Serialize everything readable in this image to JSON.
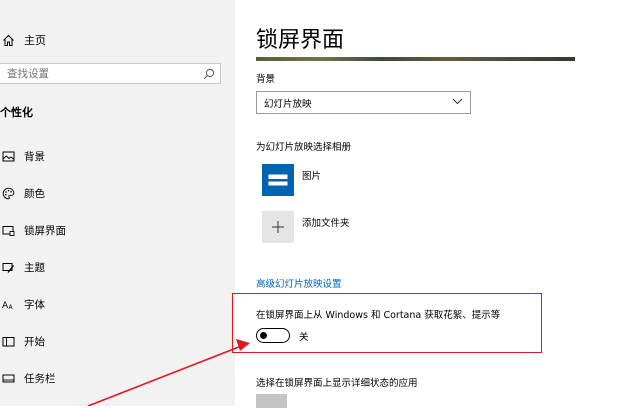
{
  "sidebar": {
    "home_label": "主页",
    "search_placeholder": "查找设置",
    "section_title": "个性化",
    "items": [
      {
        "label": "背景",
        "icon": "picture-icon"
      },
      {
        "label": "颜色",
        "icon": "palette-icon"
      },
      {
        "label": "锁屏界面",
        "icon": "lock-screen-icon"
      },
      {
        "label": "主题",
        "icon": "brush-icon"
      },
      {
        "label": "字体",
        "icon": "font-icon"
      },
      {
        "label": "开始",
        "icon": "start-icon"
      },
      {
        "label": "任务栏",
        "icon": "taskbar-icon"
      }
    ]
  },
  "main": {
    "title": "锁屏界面",
    "background_label": "背景",
    "background_selected": "幻灯片放映",
    "album_label": "为幻灯片放映选择相册",
    "albums": [
      {
        "label": "图片",
        "icon": "pictures-folder-icon"
      },
      {
        "label": "添加文件夹",
        "icon": "plus-icon"
      }
    ],
    "advanced_link": "高级幻灯片放映设置",
    "fun_facts_label": "在锁屏界面上从 Windows 和 Cortana 获取花絮、提示等",
    "fun_facts_state": "关",
    "detailed_status_label": "选择在锁屏界面上显示详细状态的应用"
  },
  "colors": {
    "accent": "#0067b8",
    "highlight": "#e2171f",
    "sidebar_bg": "#f2f2f2"
  }
}
